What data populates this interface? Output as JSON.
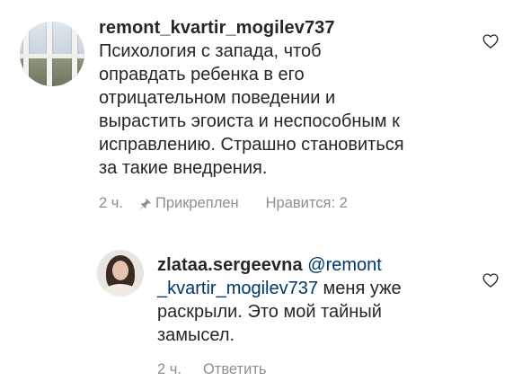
{
  "comment": {
    "username": "remont_kvartir_mogilev737",
    "text_lines": [
      "Психология с запада, чтоб",
      "оправдать ребенка в его",
      "отрицательном поведении и",
      "вырастить эгоиста и неспособным к",
      "исправлению. Страшно становиться",
      "за такие внедрения."
    ],
    "time": "2 ч.",
    "pinned_label": "Прикреплен",
    "likes_label": "Нравится: 2",
    "heart_icon": "heart-outline-icon",
    "pin_icon": "pin-icon"
  },
  "reply": {
    "username": "zlataa.sergeevna",
    "text_lines": [
      {
        "mention": "@remont",
        "text": ""
      },
      {
        "mention": "_kvartir_mogilev737",
        "text": " меня уже"
      },
      {
        "mention": "",
        "text": "раскрыли.  Это мой тайный"
      },
      {
        "mention": "",
        "text": "замысел."
      }
    ],
    "time": "2 ч.",
    "reply_label": "Ответить",
    "heart_icon": "heart-outline-icon"
  },
  "colors": {
    "text": "#262626",
    "secondary": "#8e8e8e",
    "mention": "#00376b",
    "background": "#ffffff"
  }
}
